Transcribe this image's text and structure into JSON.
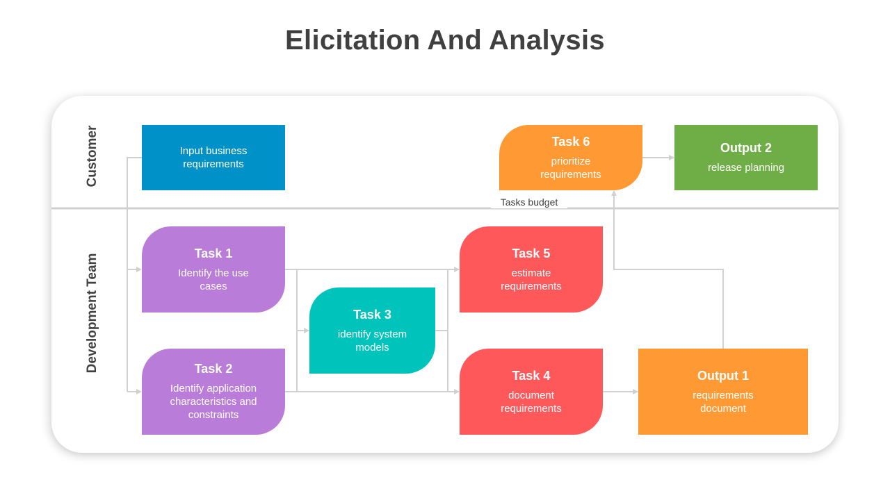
{
  "title": "Elicitation And Analysis",
  "lanes": {
    "customer": "Customer",
    "development": "Development Team"
  },
  "colors": {
    "blue": "#0091C8",
    "purple": "#B97CD8",
    "teal": "#00C4BB",
    "red": "#FF585B",
    "orange": "#FF9933",
    "green": "#6FAD47",
    "connector": "#D0D0D0",
    "text_dark": "#404040"
  },
  "nodes": {
    "input": {
      "title": "",
      "desc": "Input business requirements"
    },
    "task1": {
      "title": "Task 1",
      "desc": "Identify the use cases"
    },
    "task2": {
      "title": "Task 2",
      "desc": "Identify application characteristics and constraints"
    },
    "task3": {
      "title": "Task 3",
      "desc": "identify system models"
    },
    "task4": {
      "title": "Task 4",
      "desc": "document requirements"
    },
    "task5": {
      "title": "Task 5",
      "desc": "estimate requirements"
    },
    "task6": {
      "title": "Task 6",
      "desc": "prioritize requirements"
    },
    "output1": {
      "title": "Output 1",
      "desc": "requirements document"
    },
    "output2": {
      "title": "Output 2",
      "desc": "release planning"
    }
  },
  "annotations": {
    "tasks_budget": "Tasks budget"
  }
}
